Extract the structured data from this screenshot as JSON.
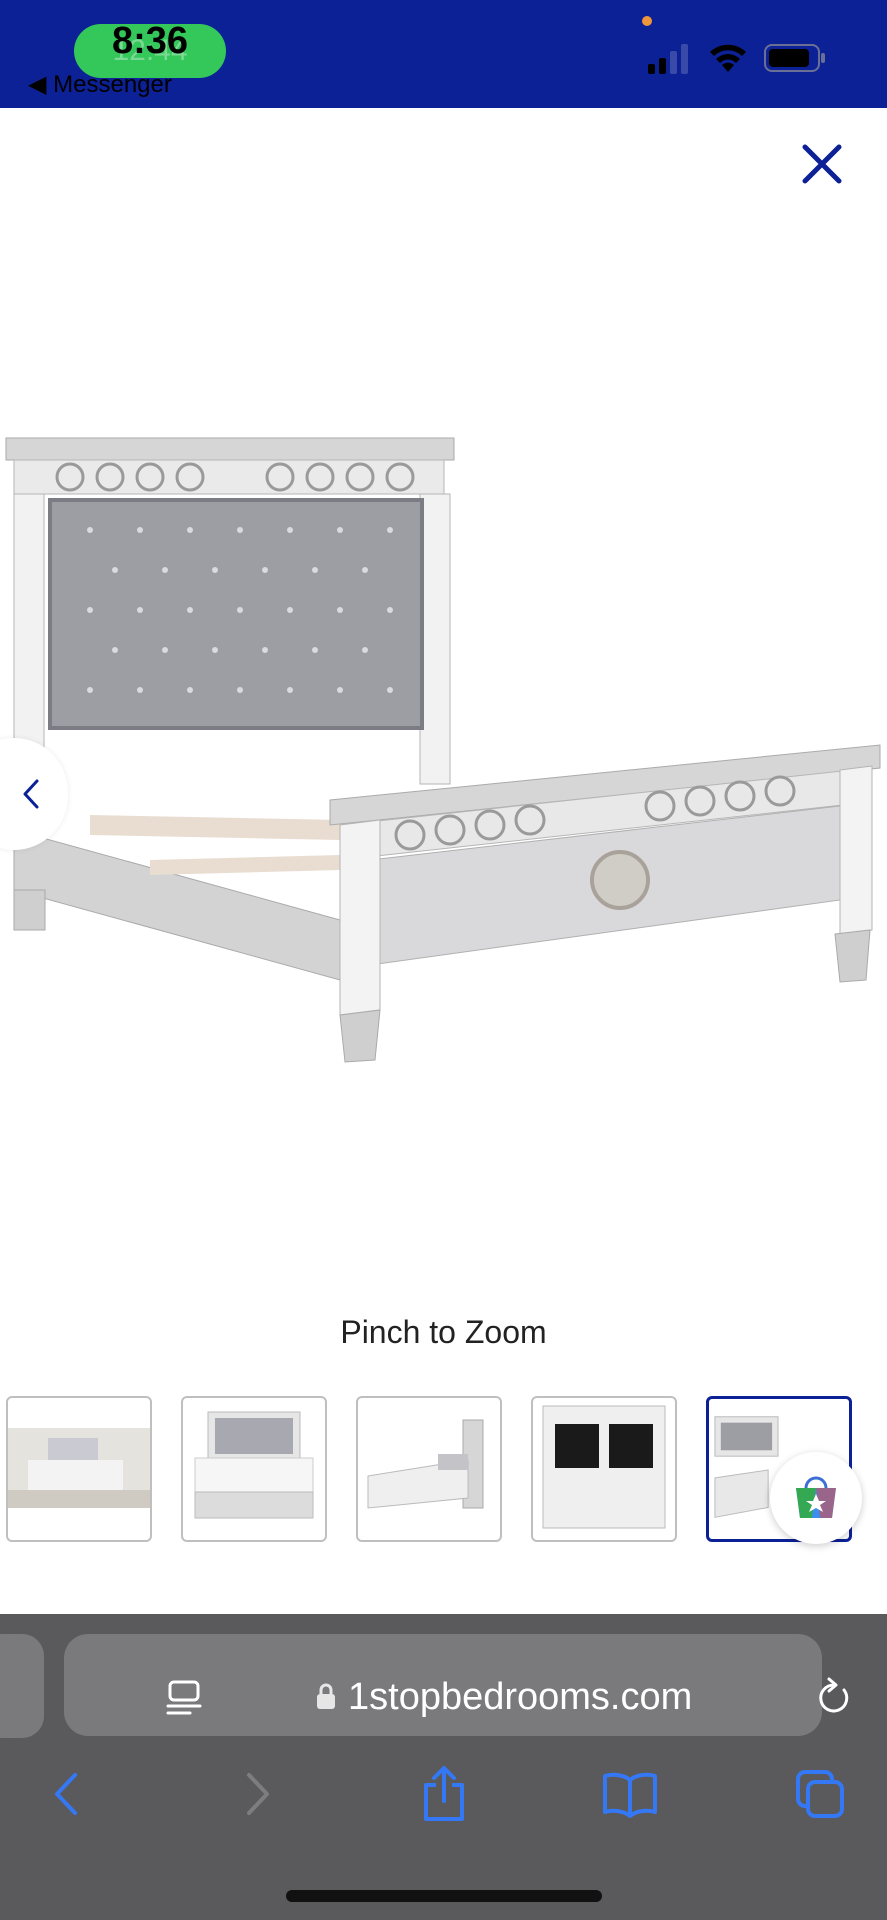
{
  "status_bar": {
    "time": "8:36",
    "ghost_time": "12:44",
    "back_app": "◀ Messenger",
    "bg_color": "#0c2196"
  },
  "product": {
    "zoom_hint": "Pinch to Zoom",
    "close_icon": "close-icon",
    "prev_icon": "chevron-left-icon"
  },
  "thumbnails": [
    {
      "name": "bedroom-set-thumbnail",
      "selected": false
    },
    {
      "name": "bed-front-thumbnail",
      "selected": false
    },
    {
      "name": "bed-side-thumbnail",
      "selected": false
    },
    {
      "name": "headboard-thumbnail",
      "selected": false
    },
    {
      "name": "bed-angle-thumbnail",
      "selected": true
    }
  ],
  "browser": {
    "url": "1stopbedrooms.com",
    "accent_color": "#3478f6"
  }
}
